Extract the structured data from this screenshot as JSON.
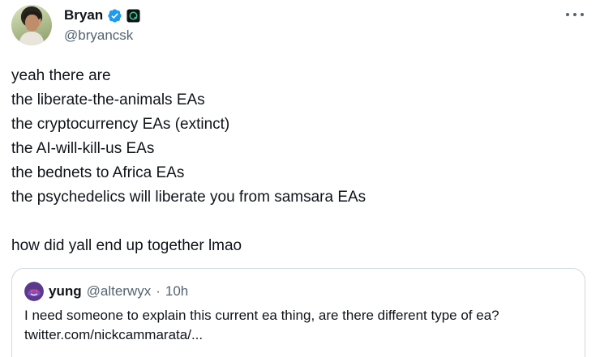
{
  "author": {
    "display_name": "Bryan",
    "handle": "@bryancsk",
    "verified": true,
    "verified_color": "#1d9bf0",
    "affiliate_badge": "square-logo-icon"
  },
  "tweet": {
    "lines": [
      "yeah there are",
      "the liberate-the-animals EAs",
      "the cryptocurrency EAs (extinct)",
      "the AI-will-kill-us EAs",
      "the bednets to Africa EAs",
      "the psychedelics will liberate you from samsara EAs",
      "",
      "how did yall end up together lmao"
    ]
  },
  "quote": {
    "display_name": "yung",
    "handle": "@alterwyx",
    "separator": "·",
    "time": "10h",
    "lines": [
      "I need someone to explain this current ea thing, are there different type of ea?",
      "twitter.com/nickcammarata/..."
    ]
  },
  "colors": {
    "text_primary": "#0f1419",
    "text_secondary": "#536471",
    "border": "#cfd9de"
  }
}
